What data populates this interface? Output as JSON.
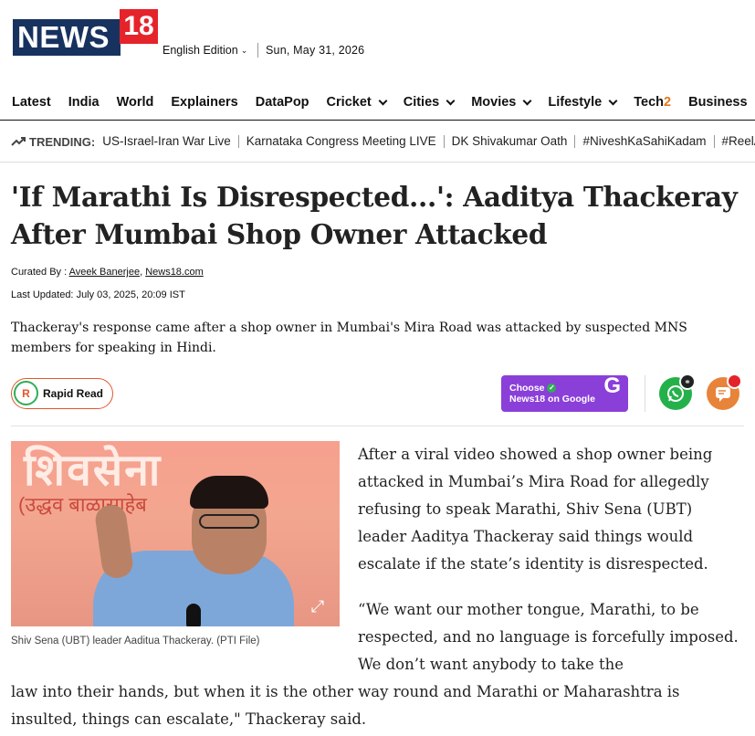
{
  "brand": {
    "logo_text": "NEWS",
    "logo_num": "18"
  },
  "header": {
    "edition": "English Edition",
    "date": "Sun, May 31, 2026"
  },
  "nav": {
    "items": [
      {
        "label": "Latest",
        "dropdown": false
      },
      {
        "label": "India",
        "dropdown": false
      },
      {
        "label": "World",
        "dropdown": false
      },
      {
        "label": "Explainers",
        "dropdown": false
      },
      {
        "label": "DataPop",
        "dropdown": false
      },
      {
        "label": "Cricket",
        "dropdown": true
      },
      {
        "label": "Cities",
        "dropdown": true
      },
      {
        "label": "Movies",
        "dropdown": true
      },
      {
        "label": "Lifestyle",
        "dropdown": true
      },
      {
        "label": "Tech",
        "suffix": "2",
        "dropdown": false
      },
      {
        "label": "Business",
        "dropdown": false
      }
    ]
  },
  "trending": {
    "label": "TRENDING:",
    "items": [
      "US-Israel-Iran War Live",
      "Karnataka Congress Meeting LIVE",
      "DK Shivakumar Oath",
      "#NiveshKaSahiKadam",
      "#ReelA"
    ]
  },
  "article": {
    "headline": "'If Marathi Is Disrespected...': Aaditya Thackeray After Mumbai Shop Owner Attacked",
    "curated_label": "Curated By :",
    "author": "Aveek Banerjee",
    "author_sep": ", ",
    "publisher": "News18.com",
    "updated_label": "Last Updated:",
    "updated_value": "July 03, 2025, 20:09 IST",
    "summary": "Thackeray's response came after a shop owner in Mumbai's Mira Road was attacked by suspected MNS members for speaking in Hindi.",
    "rapid_read": "Rapid Read",
    "google_line1": "Choose",
    "google_line2": "News18 on Google",
    "image_caption": "Shiv Sena (UBT) leader Aaditua Thackeray. (PTI File)",
    "image_banner_1": "शिवसेना",
    "image_banner_2": "(उद्धव बाळासाहेब",
    "p1": "After a viral video showed a shop owner being attacked in Mumbai’s Mira Road for allegedly refusing to speak Marathi, Shiv Sena (UBT) leader Aaditya Thackeray said things would escalate if the state’s identity is disrespected.",
    "p2_part1": "“We want our mother tongue, Marathi, to be respected, and no language is forcefully imposed. We don’t want anybody to take the",
    "p2_part2": "law into their hands, but when it is the other way round and Marathi or Maharashtra is insulted, things can escalate,\" Thackeray said."
  },
  "colors": {
    "brand_navy": "#17325f",
    "brand_red": "#e5232b",
    "google_purple": "#8b3fd9",
    "whatsapp_green": "#25b14a",
    "comment_orange": "#e8833a"
  }
}
